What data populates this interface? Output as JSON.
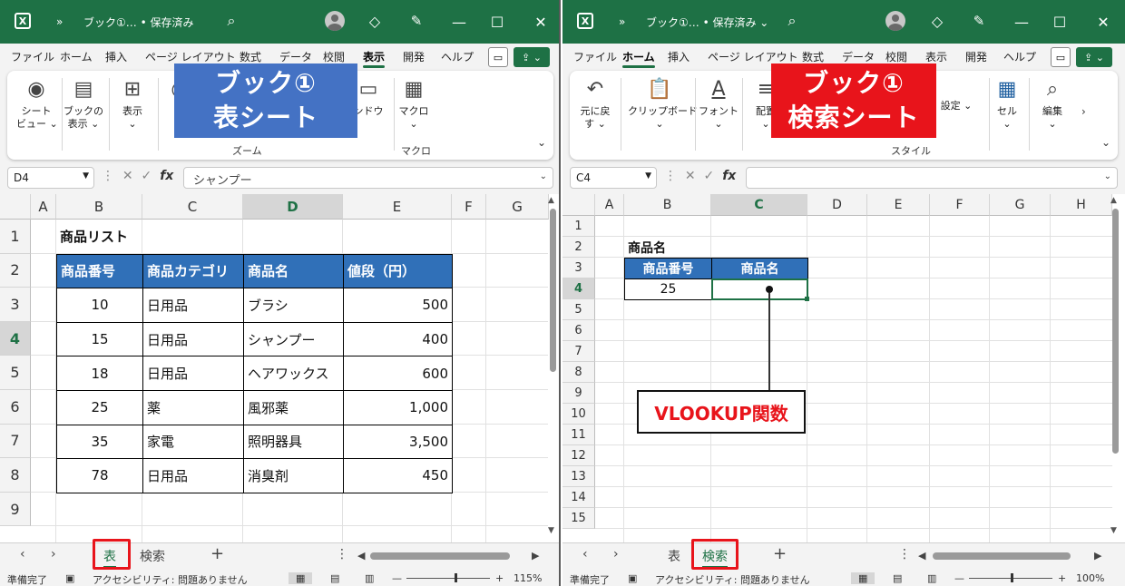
{
  "left": {
    "title": "ブック①… • 保存済み",
    "tabs": [
      "ファイル",
      "ホーム",
      "挿入",
      "ページ レイアウト",
      "数式",
      "データ",
      "校閲",
      "表示",
      "開発",
      "ヘルプ"
    ],
    "active_tab": "表示",
    "ribbon": {
      "sheet_view_l1": "シート",
      "sheet_view_l2": "ビュー ⌄",
      "book_view_l1": "ブックの",
      "book_view_l2": "表示 ⌄",
      "show_l1": "表示",
      "show_l2": "⌄",
      "partial": "ズ",
      "window_partial": "ンドウ",
      "macro_l1": "マクロ",
      "macro_l2": "⌄",
      "group_zoom": "ズーム",
      "group_macro": "マクロ"
    },
    "overlay_line1": "ブック①",
    "overlay_line2": "表シート",
    "namebox": "D4",
    "formula": "シャンプー",
    "columns": [
      "A",
      "B",
      "C",
      "D",
      "E",
      "F",
      "G"
    ],
    "rows": [
      "1",
      "2",
      "3",
      "4",
      "5",
      "6",
      "7",
      "8",
      "9"
    ],
    "table_title": "商品リスト",
    "headers": [
      "商品番号",
      "商品カテゴリ",
      "商品名",
      "値段（円）"
    ],
    "data_rows": [
      [
        "10",
        "日用品",
        "ブラシ",
        "500"
      ],
      [
        "15",
        "日用品",
        "シャンプー",
        "400"
      ],
      [
        "18",
        "日用品",
        "ヘアワックス",
        "600"
      ],
      [
        "25",
        "薬",
        "風邪薬",
        "1,000"
      ],
      [
        "35",
        "家電",
        "照明器具",
        "3,500"
      ],
      [
        "78",
        "日用品",
        "消臭剤",
        "450"
      ]
    ],
    "sheet_tabs": [
      "表",
      "検索"
    ],
    "active_sheet": "表",
    "status": "準備完了",
    "accessibility": "アクセシビリティ: 問題ありません",
    "zoom": "115%",
    "zoom_level": 0.58
  },
  "right": {
    "title": "ブック①… • 保存済み ⌄",
    "tabs": [
      "ファイル",
      "ホーム",
      "挿入",
      "ページ レイアウト",
      "数式",
      "データ",
      "校閲",
      "表示",
      "開発",
      "ヘルプ"
    ],
    "active_tab": "ホーム",
    "ribbon": {
      "undo_l1": "元に戻",
      "undo_l2": "す ⌄",
      "clipboard_l1": "クリップボード",
      "clipboard_l2": "⌄",
      "font_l1": "フォント",
      "font_l2": "⌄",
      "align_l1": "配置",
      "align_l2": "⌄",
      "setting_partial": "設定 ⌄",
      "cells_l1": "セル",
      "cells_l2": "⌄",
      "edit_l1": "編集",
      "edit_l2": "⌄",
      "group_style": "スタイル"
    },
    "overlay_line1": "ブック①",
    "overlay_line2": "検索シート",
    "namebox": "C4",
    "formula": "",
    "columns": [
      "A",
      "B",
      "C",
      "D",
      "E",
      "F",
      "G",
      "H"
    ],
    "rows": [
      "1",
      "2",
      "3",
      "4",
      "5",
      "6",
      "7",
      "8",
      "9",
      "10",
      "11",
      "12",
      "13",
      "14",
      "15"
    ],
    "label": "商品名",
    "headers": [
      "商品番号",
      "商品名"
    ],
    "value": "25",
    "callout": "VLOOKUP関数",
    "sheet_tabs": [
      "表",
      "検索"
    ],
    "active_sheet": "検索",
    "status": "準備完了",
    "accessibility": "アクセシビリティ: 問題ありません",
    "zoom": "100%",
    "zoom_level": 0.5
  },
  "colors": {
    "titlebar": "#1e7145",
    "table_header": "#3070b8",
    "overlay_blue": "#4472c4",
    "overlay_red": "#e8141b",
    "highlight": "#e8141b"
  }
}
